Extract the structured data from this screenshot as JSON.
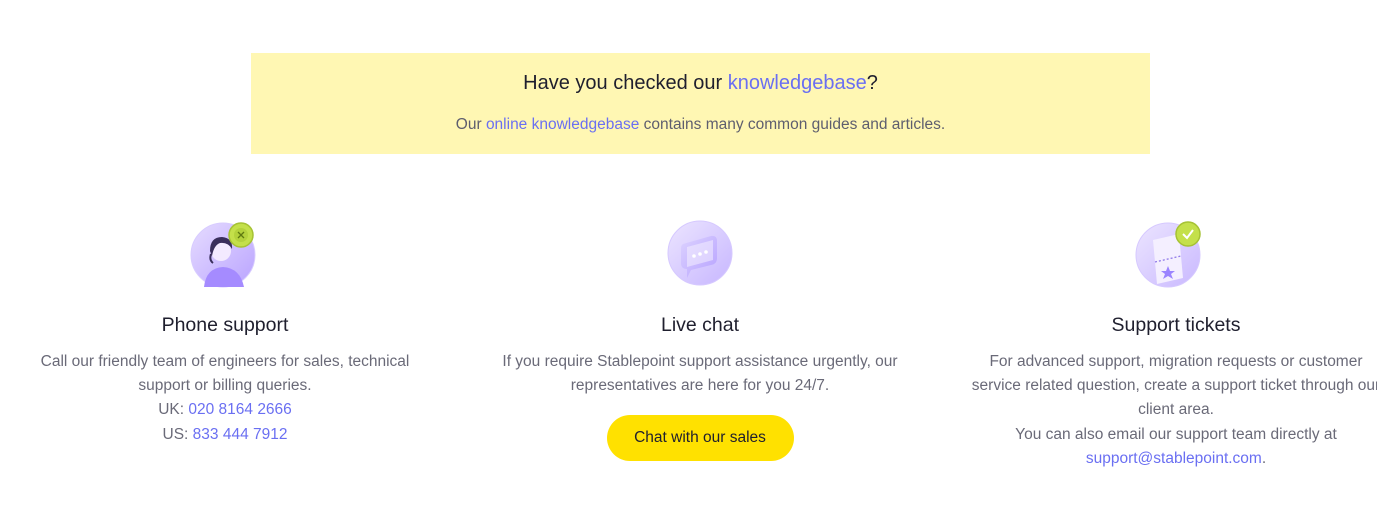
{
  "banner": {
    "title_prefix": "Have you checked our ",
    "title_link": "knowledgebase",
    "title_suffix": "?",
    "sub_prefix": "Our ",
    "sub_link": "online knowledgebase",
    "sub_suffix": " contains many common guides and articles."
  },
  "phone": {
    "icon": "headset-agent-icon",
    "title": "Phone support",
    "text": "Call our friendly team of engineers for sales, technical support or billing queries.",
    "uk_label": "UK: ",
    "uk_number": "020 8164 2666",
    "us_label": "US: ",
    "us_number": "833 444 7912"
  },
  "chat": {
    "icon": "chat-bubble-icon",
    "title": "Live chat",
    "text": "If you require Stablepoint support assistance urgently, our representatives are here for you 24/7.",
    "button_label": "Chat with our sales"
  },
  "tickets": {
    "icon": "ticket-icon",
    "title": "Support tickets",
    "text": "For advanced support, migration requests or customer service related question, create a support ticket through our client area.",
    "email_prefix": "You can also email our support team directly at",
    "email": "support@stablepoint.com",
    "email_suffix": "."
  },
  "colors": {
    "accent_link": "#6a6ff2",
    "banner_bg": "#fff7b3",
    "button_bg": "#ffe100",
    "icon_purple": "#c9b8ff",
    "badge_green": "#c4e04a"
  }
}
